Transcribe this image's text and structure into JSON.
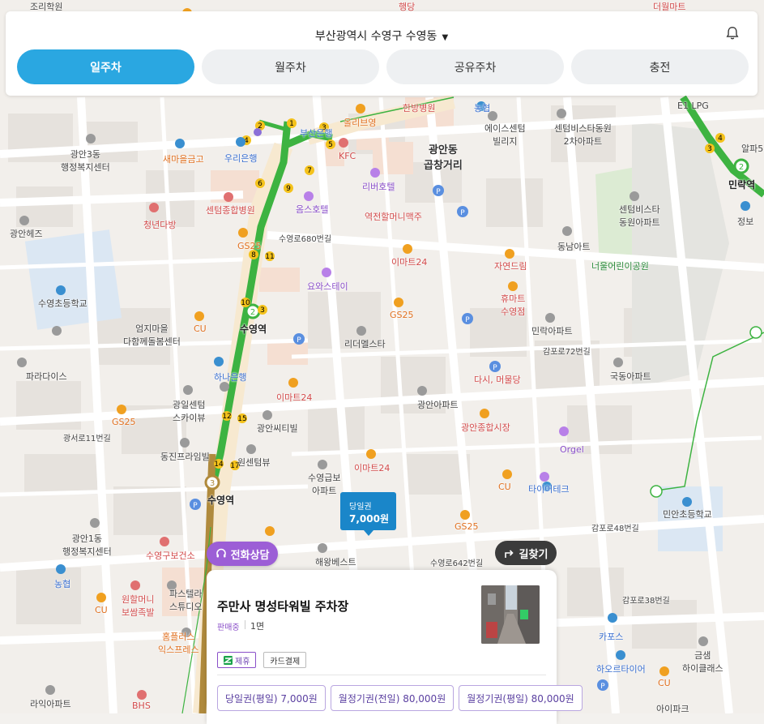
{
  "header": {
    "location": "부산광역시 수영구 수영동",
    "tabs": [
      {
        "label": "일주차",
        "active": true
      },
      {
        "label": "월주차",
        "active": false
      },
      {
        "label": "공유주차",
        "active": false
      },
      {
        "label": "충전",
        "active": false
      }
    ]
  },
  "map_labels": {
    "l1": "조리학원",
    "l2": "광안3동\n행정복지센터",
    "l3": "새마을금고",
    "l4": "우리은행",
    "l5": "센텀종합병원",
    "l6": "청년다방",
    "l7": "광안헤즈",
    "l8": "수영초등학교",
    "l9": "엄지마을\n다함께돌봄센터",
    "l10": "파라다이스",
    "l11": "광일센텀\n스카이뷰",
    "l12": "동진프라임빌",
    "l13": "광안1동\n행정복지센터",
    "l14": "수영구보건소",
    "l15": "원할머니\n보쌈족발",
    "l16": "파스텔라\n스튜디오",
    "l17": "홈플러스\n익스프레스",
    "l18": "라익아파트",
    "l19": "부산은행",
    "l20": "올리브영",
    "l21": "KFC",
    "l22": "리버호텔",
    "l23": "옴스호텔",
    "l24": "역전할머니맥주",
    "l25": "이마트24",
    "l26": "요와스테이",
    "l27": "GS25",
    "l28": "리더멜스타",
    "l29": "하나은행",
    "l30": "광안씨티빌",
    "l31": "원센텀뷰",
    "l32": "수영급보\n아파트",
    "l33": "해왕베스트",
    "l34": "광안동\n곱창거리",
    "l35": "에이스센텀\n빌리지",
    "l36": "센텀비스타동원\n2차아파트",
    "l37": "자연드림",
    "l38": "휴마트\n수영점",
    "l39": "동남아트",
    "l40": "센텀비스타\n동원아파트",
    "l41": "너울어린이공원",
    "l42": "민락아파트",
    "l43": "국동아파트",
    "l44": "다시, 머물당",
    "l45": "광안아파트",
    "l46": "광안종합시장",
    "l47": "Orgel",
    "l48": "타이어테크",
    "l49": "민안초등학교",
    "l50": "하오르타이어",
    "l51": "카포스",
    "l52": "금샘\n하이클래스",
    "l53": "민락역",
    "l54": "수영역",
    "l55": "수영역",
    "l56": "E1 LPG",
    "l57": "한방병원",
    "l58": "농협",
    "l59": "CU",
    "l60": "이마트24",
    "l61": "이마트24",
    "l62": "CU",
    "l63": "GS25",
    "l64": "CU",
    "l65": "GS25",
    "l66": "수영로680번길",
    "l67": "수영로642번길",
    "l68": "광서로11번길",
    "l69": "감포로48번길",
    "l70": "감포로38번길",
    "l71": "감포로72번길",
    "l72": "알파5",
    "l73": "더월마트",
    "l74": "행당",
    "l75": "농협",
    "l76": "CU",
    "l77": "GS25",
    "l78": "정보",
    "l79": "BHS",
    "l80": "아이파크"
  },
  "price_marker": {
    "type": "당일권",
    "price": "7,000원"
  },
  "buttons": {
    "consult": "전화상담",
    "directions": "길찾기"
  },
  "lot": {
    "name": "주만사 명성타워빌 주차장",
    "status": "판매중",
    "spaces": "1면",
    "tags": [
      "제휴",
      "카드결제"
    ],
    "prices": [
      "당일권(평일) 7,000원",
      "월정기권(전일) 80,000원",
      "월정기권(평일) 80,000원"
    ]
  }
}
